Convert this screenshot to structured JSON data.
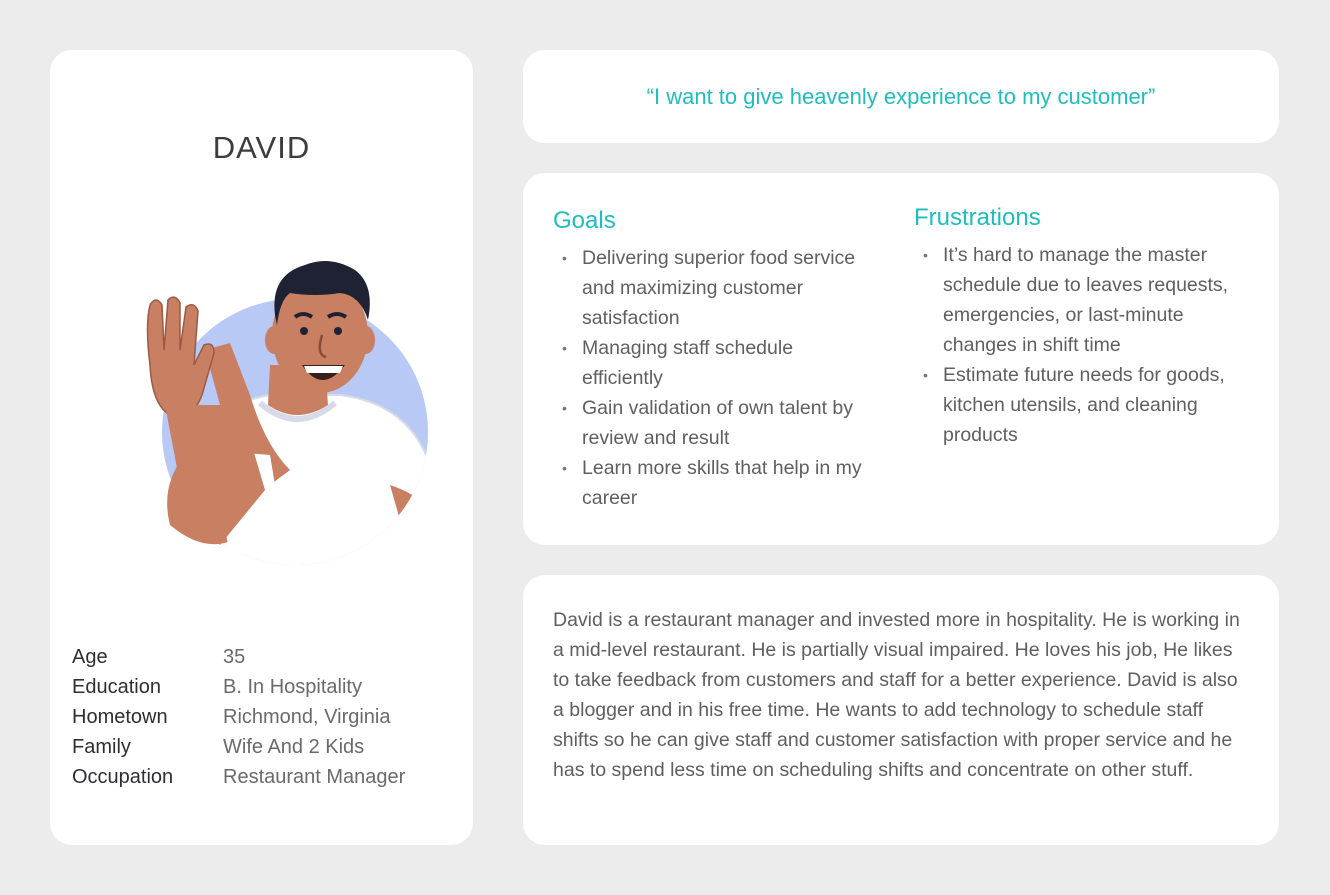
{
  "profile": {
    "name": "DAVID",
    "details": [
      {
        "label": "Age",
        "value": "35"
      },
      {
        "label": "Education",
        "value": "B. In Hospitality"
      },
      {
        "label": "Hometown",
        "value": "Richmond, Virginia"
      },
      {
        "label": "Family",
        "value": "Wife And 2 Kids"
      },
      {
        "label": "Occupation",
        "value": "Restaurant Manager"
      }
    ]
  },
  "quote": "“I want to give heavenly experience to my customer”",
  "goals": {
    "title": "Goals",
    "items": [
      "Delivering superior food service and maximizing customer satisfaction",
      "Managing staff schedule efficiently",
      "Gain validation of own talent by review and result",
      "Learn more skills that help in my career"
    ]
  },
  "frustrations": {
    "title": "Frustrations",
    "items": [
      "It’s hard to manage the master schedule due to leaves requests, emergencies, or last-minute changes in shift time",
      "Estimate future needs for goods, kitchen utensils, and cleaning products"
    ]
  },
  "bio": "David is a restaurant manager and invested more in hospitality. He is working in a mid-level restaurant. He is partially visual impaired. He loves his job, He likes to take feedback from customers and staff for a better experience. David is also a blogger and in his free time. He wants to add technology to schedule staff shifts so he can give staff and customer satisfaction with proper service and he has to spend less time on scheduling shifts and concentrate on other stuff.",
  "colors": {
    "accent": "#1fbdbd",
    "background": "#ececec",
    "card": "#ffffff",
    "avatar_circle": "#b8c9f5",
    "skin": "#c97f62",
    "hair": "#1f2233"
  }
}
